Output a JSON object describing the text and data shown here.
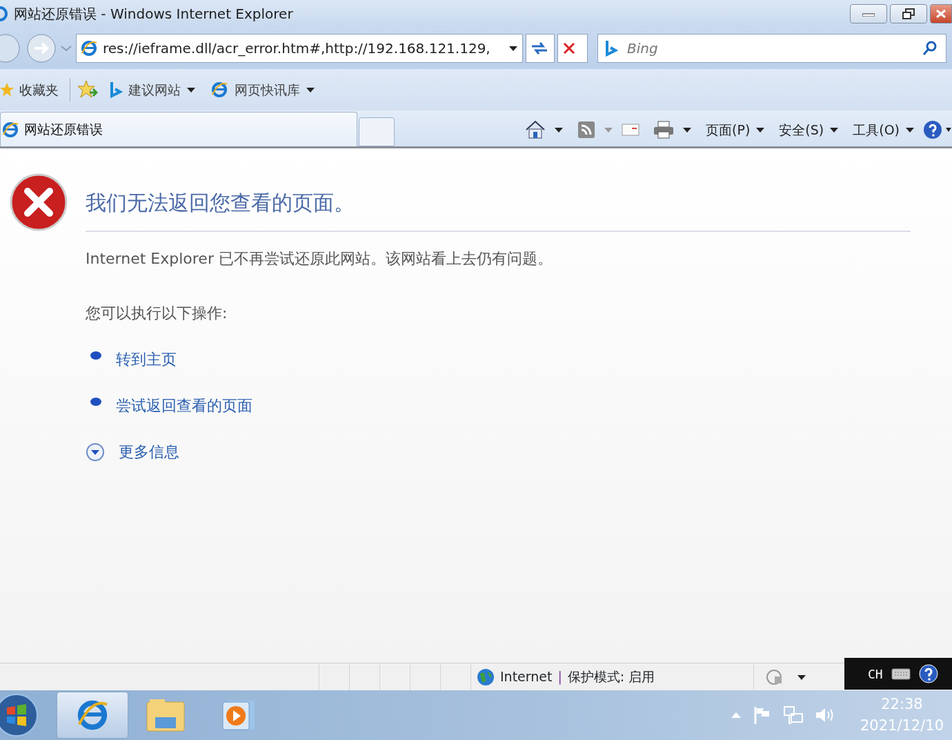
{
  "window": {
    "title": "网站还原错误 - Windows Internet Explorer"
  },
  "address_bar": {
    "url": "res://ieframe.dll/acr_error.htm#,http://192.168.121.129,"
  },
  "search": {
    "placeholder": "Bing"
  },
  "favorites_bar": {
    "favorites": "收藏夹",
    "items": [
      {
        "label": "建议网站",
        "kind": "bing"
      },
      {
        "label": "网页快讯库",
        "kind": "ie"
      }
    ]
  },
  "tabs": [
    {
      "label": "网站还原错误",
      "selected": true
    }
  ],
  "command_bar": {
    "menus": [
      "页面(P)",
      "安全(S)",
      "工具(O)"
    ]
  },
  "page": {
    "heading": "我们无法返回您查看的页面。",
    "message": "Internet Explorer 已不再尝试还原此网站。该网站看上去仍有问题。",
    "prompt": "您可以执行以下操作:",
    "actions": [
      {
        "kind": "link",
        "label": "转到主页"
      },
      {
        "kind": "link",
        "label": "尝试返回查看的页面"
      },
      {
        "kind": "expander",
        "label": "更多信息",
        "expanded": false
      }
    ]
  },
  "status_bar": {
    "zone": "Internet",
    "separator": "|",
    "protected_mode": "保护模式: 启用"
  },
  "language_bar": {
    "language": "CH"
  },
  "taskbar": {
    "time": "22:38",
    "date": "2021/12/10"
  }
}
